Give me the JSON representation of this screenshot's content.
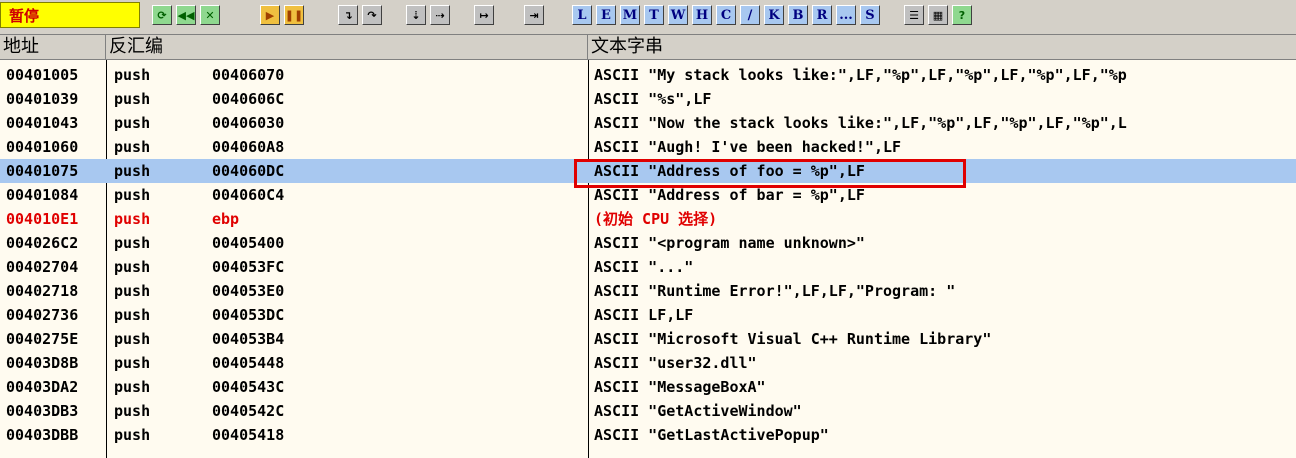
{
  "status_label": "暂停",
  "toolbar_letters": [
    "L",
    "E",
    "M",
    "T",
    "W",
    "H",
    "C",
    "/",
    "K",
    "B",
    "R",
    "...",
    "S"
  ],
  "columns": {
    "addr": "地址",
    "disasm": "反汇编",
    "text": "文本字串"
  },
  "rows": [
    {
      "addr": "00401005",
      "op": "push",
      "arg": "00406070",
      "text": "ASCII \"My stack looks like:\",LF,\"%p\",LF,\"%p\",LF,\"%p\",LF,\"%p"
    },
    {
      "addr": "00401039",
      "op": "push",
      "arg": "0040606C",
      "text": "ASCII \"%s\",LF"
    },
    {
      "addr": "00401043",
      "op": "push",
      "arg": "00406030",
      "text": "ASCII \"Now the stack looks like:\",LF,\"%p\",LF,\"%p\",LF,\"%p\",L"
    },
    {
      "addr": "00401060",
      "op": "push",
      "arg": "004060A8",
      "text": "ASCII \"Augh! I've been hacked!\",LF"
    },
    {
      "addr": "00401075",
      "op": "push",
      "arg": "004060DC",
      "text": "ASCII \"Address of foo = %p\",LF"
    },
    {
      "addr": "00401084",
      "op": "push",
      "arg": "004060C4",
      "text": "ASCII \"Address of bar = %p\",LF"
    },
    {
      "addr": "004010E1",
      "op": "push",
      "arg": "ebp",
      "text": "(初始 CPU 选择)"
    },
    {
      "addr": "004026C2",
      "op": "push",
      "arg": "00405400",
      "text": "ASCII \"<program name unknown>\""
    },
    {
      "addr": "00402704",
      "op": "push",
      "arg": "004053FC",
      "text": "ASCII \"...\""
    },
    {
      "addr": "00402718",
      "op": "push",
      "arg": "004053E0",
      "text": "ASCII \"Runtime Error!\",LF,LF,\"Program: \""
    },
    {
      "addr": "00402736",
      "op": "push",
      "arg": "004053DC",
      "text": "ASCII LF,LF"
    },
    {
      "addr": "0040275E",
      "op": "push",
      "arg": "004053B4",
      "text": "ASCII \"Microsoft Visual C++ Runtime Library\""
    },
    {
      "addr": "00403D8B",
      "op": "push",
      "arg": "00405448",
      "text": "ASCII \"user32.dll\""
    },
    {
      "addr": "00403DA2",
      "op": "push",
      "arg": "0040543C",
      "text": "ASCII \"MessageBoxA\""
    },
    {
      "addr": "00403DB3",
      "op": "push",
      "arg": "0040542C",
      "text": "ASCII \"GetActiveWindow\""
    },
    {
      "addr": "00403DBB",
      "op": "push",
      "arg": "00405418",
      "text": "ASCII \"GetLastActivePopup\""
    }
  ],
  "selected_row": 4,
  "red_row": 6
}
